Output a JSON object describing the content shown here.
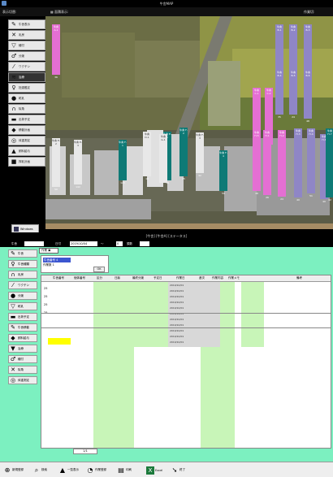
{
  "top_window": {
    "title": "牛舎MAP",
    "menu": {
      "left": "表示切替:",
      "center": "▦ 面積表示:",
      "right": "作業切:"
    },
    "toolbar": [
      {
        "label": "牛舎表示",
        "icon": "pencil-icon",
        "glyph": "✎"
      },
      {
        "label": "乳房",
        "icon": "x-icon",
        "glyph": "✕"
      },
      {
        "label": "種付",
        "icon": "cup-icon",
        "glyph": "▽"
      },
      {
        "label": "分娩",
        "icon": "male-icon",
        "glyph": "♂"
      },
      {
        "label": "ワクチン",
        "icon": "syringe-icon",
        "glyph": "⁄"
      },
      {
        "label": "治療",
        "icon": "wave-icon",
        "glyph": "≋"
      },
      {
        "label": "妊娠鑑定",
        "icon": "female-icon",
        "glyph": "♀"
      },
      {
        "label": "乾乳",
        "icon": "drop-icon",
        "glyph": "●"
      },
      {
        "label": "除角",
        "icon": "horn-icon",
        "glyph": "∩"
      },
      {
        "label": "出荷予定",
        "icon": "truck-icon",
        "glyph": "▬"
      },
      {
        "label": "移動計画",
        "icon": "cow-icon",
        "glyph": "◆"
      },
      {
        "label": "体重測定",
        "icon": "scale-icon",
        "glyph": "◎"
      },
      {
        "label": "飼料給与",
        "icon": "feed-icon",
        "glyph": "▲"
      },
      {
        "label": "搾乳計画",
        "icon": "barn-icon",
        "glyph": "■"
      }
    ],
    "bottom_tool": "Windows",
    "status": "[牛舎] [牛舎A] [ステータス]",
    "tags": [
      {
        "color": "pink",
        "text": "牛舎 A-1",
        "num": "36"
      },
      {
        "color": "purple",
        "text": "牛舎 B-1",
        "num": "29"
      },
      {
        "color": "purple",
        "text": "牛舎 B-2",
        "num": "31"
      },
      {
        "color": "purple",
        "text": "牛舎 B-3",
        "num": "29"
      },
      {
        "color": "purple",
        "text": "牛舎 B-4",
        "num": "35"
      },
      {
        "color": "purple",
        "text": "牛舎 B-5",
        "num": "24"
      },
      {
        "color": "purple",
        "text": "牛舎 B-6",
        "num": "48"
      },
      {
        "color": "pink",
        "text": "牛舎 C-1",
        "num": "28"
      },
      {
        "color": "pink",
        "text": "牛舎 C-2",
        "num": "24"
      },
      {
        "color": "white",
        "text": "牛舎 D-1",
        "num": "18"
      },
      {
        "color": "teal",
        "text": "牛舎 E-1",
        "num": "18"
      },
      {
        "color": "white",
        "text": "牛舎 E-2",
        "num": "50"
      },
      {
        "color": "white",
        "text": "牛舎 E-3",
        "num": "142"
      },
      {
        "color": "teal",
        "text": "牛舎 F-1",
        "num": "123"
      },
      {
        "color": "teal",
        "text": "牛舎 F-2",
        "num": "45"
      },
      {
        "color": "white",
        "text": "牛舎 F-3",
        "num": "42"
      },
      {
        "color": "teal",
        "text": "牛舎 F-4",
        "num": "59"
      },
      {
        "color": "white",
        "text": "牛舎 G-1",
        "num": ""
      },
      {
        "color": "pink",
        "text": "牛舎 H-1",
        "num": "26"
      },
      {
        "color": "pink",
        "text": "牛舎 H-2",
        "num": "24"
      },
      {
        "color": "purple",
        "text": "牛舎 H-3",
        "num": "40"
      },
      {
        "color": "purple",
        "text": "牛舎 H-4",
        "num": "51"
      },
      {
        "color": "pink",
        "text": "牛舎 H-5",
        "num": "46"
      },
      {
        "color": "purple",
        "text": "牛舎 H-6",
        "num": "40"
      },
      {
        "color": "teal",
        "text": "牛舎 H-7",
        "num": "42"
      }
    ]
  },
  "bottom_window": {
    "filter": {
      "label1": "牛舎",
      "value1": "",
      "label2": "日付",
      "value2": "2019/10/04",
      "label3": "～",
      "value3": "0",
      "label4": "頭数"
    },
    "tab": "作業 ▣",
    "info": {
      "selected": "牛舎番号 4",
      "row2": "作業数 1",
      "button": "OK"
    },
    "sidebar": [
      {
        "label": "牛舎",
        "icon": "pencil-icon",
        "glyph": "✎"
      },
      {
        "label": "牛舎種類",
        "icon": "female-icon",
        "glyph": "♀"
      },
      {
        "label": "乳房",
        "icon": "horn-icon",
        "glyph": "∩"
      },
      {
        "label": "ワクチン",
        "icon": "syringe-icon",
        "glyph": "⁄"
      },
      {
        "label": "分娩",
        "icon": "drop-icon",
        "glyph": "●"
      },
      {
        "label": "乾乳",
        "icon": "cup-icon",
        "glyph": "▽"
      },
      {
        "label": "出荷予定",
        "icon": "truck-icon",
        "glyph": "▬"
      },
      {
        "label": "牛舎移動",
        "icon": "pencil-icon",
        "glyph": "✎"
      },
      {
        "label": "飼料給与",
        "icon": "cow-icon",
        "glyph": "◆"
      },
      {
        "label": "治療",
        "icon": "bucket-icon",
        "glyph": "▼"
      },
      {
        "label": "種付",
        "icon": "male-icon",
        "glyph": "♂"
      },
      {
        "label": "除角",
        "icon": "x-icon",
        "glyph": "✕"
      },
      {
        "label": "体重測定",
        "icon": "scale-icon",
        "glyph": "◎"
      }
    ],
    "columns": [
      "牛舎番号",
      "個体番号",
      "区分",
      "日齢",
      "最終分娩",
      "予定日",
      "作業日",
      "産次",
      "作業内容",
      "作業メモ",
      "備考"
    ],
    "dates": [
      "2019/10/01",
      "2019/10/01",
      "2019/10/01",
      "2019/10/01",
      "2019/10/01",
      "2019/10/01",
      "2019/10/01",
      "2019/10/01",
      "2019/10/01",
      "2019/10/01",
      "2019/10/01"
    ],
    "marks": [
      "25",
      "25",
      "25",
      "25"
    ],
    "page": "1/1",
    "footer": [
      {
        "label": "新規登録",
        "icon": "plus-icon",
        "glyph": "⊕"
      },
      {
        "label": "検索",
        "icon": "search-icon",
        "glyph": "⌕"
      },
      {
        "label": "一覧表示",
        "icon": "cow-icon",
        "glyph": "▲"
      },
      {
        "label": "作業登録",
        "icon": "clock-icon",
        "glyph": "◔"
      },
      {
        "label": "印刷",
        "icon": "printer-icon",
        "glyph": "▤"
      },
      {
        "label": "Excel",
        "icon": "excel-icon",
        "glyph": "X"
      },
      {
        "label": "終了",
        "icon": "exit-icon",
        "glyph": "➘"
      }
    ]
  }
}
